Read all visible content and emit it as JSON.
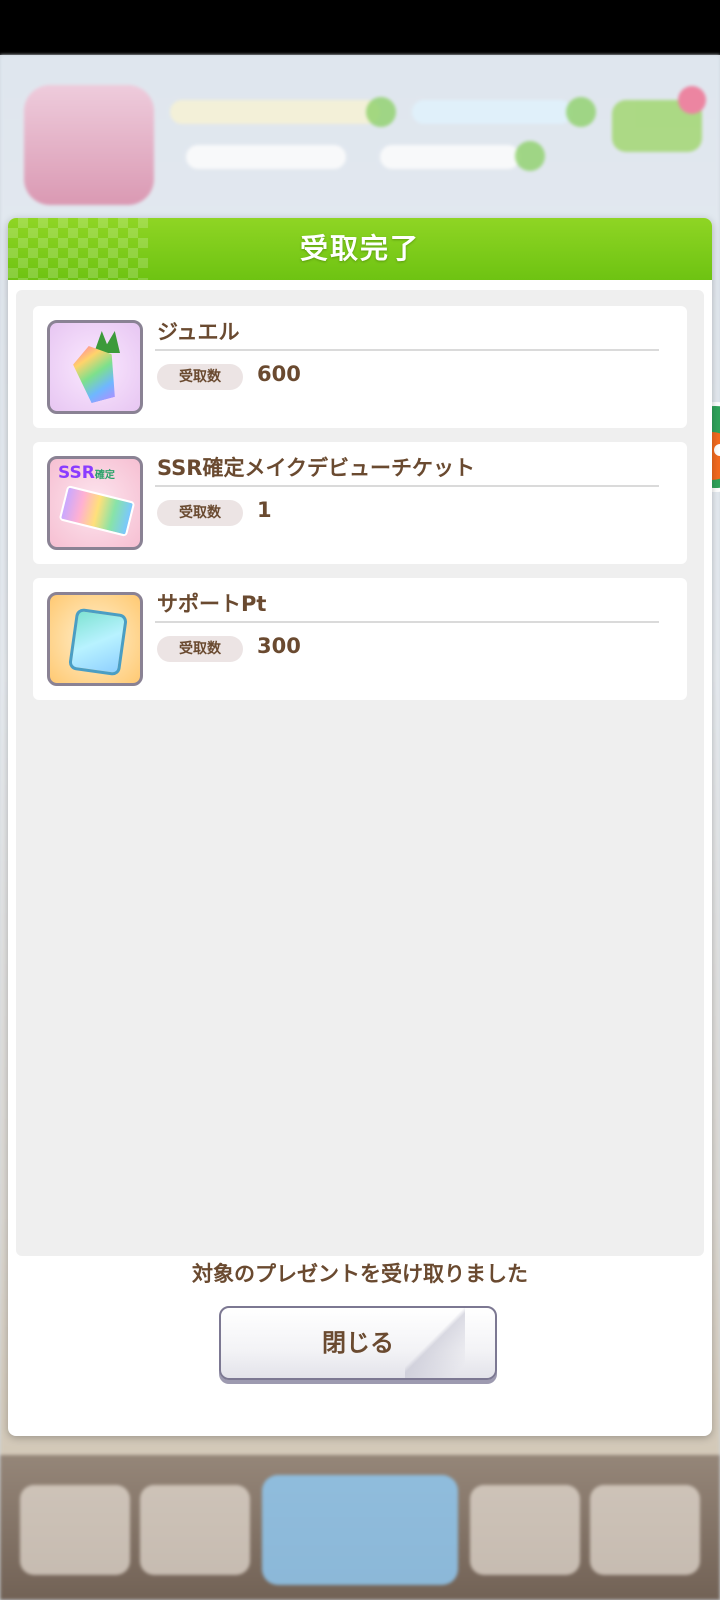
{
  "dialog": {
    "title": "受取完了",
    "message": "対象のプレゼントを受け取りました",
    "close_label": "閉じる",
    "items": [
      {
        "name": "ジュエル",
        "quantity_label": "受取数",
        "quantity": "600",
        "icon": "jewel-icon"
      },
      {
        "name": "SSR確定メイクデビューチケット",
        "quantity_label": "受取数",
        "quantity": "1",
        "icon": "ticket-icon",
        "icon_text": "SSR",
        "icon_subtext": "確定"
      },
      {
        "name": "サポートPt",
        "quantity_label": "受取数",
        "quantity": "300",
        "icon": "support-pt-icon"
      }
    ]
  },
  "colors": {
    "header_green": "#7cc91a",
    "text_brown": "#6a4a30",
    "panel_gray": "#efefef"
  }
}
